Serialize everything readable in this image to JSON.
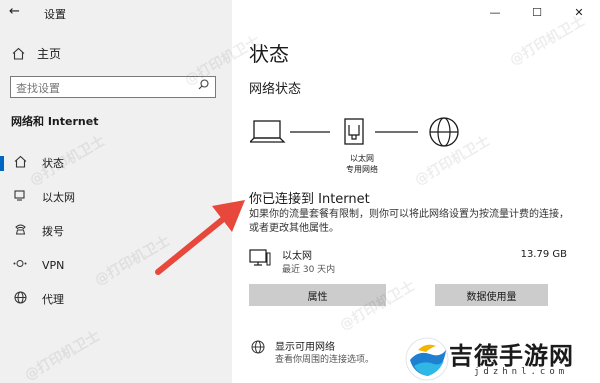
{
  "window": {
    "back_glyph": "←",
    "title": "设置",
    "min_glyph": "—",
    "max_glyph": "☐",
    "close_glyph": "✕"
  },
  "sidebar": {
    "home_label": "主页",
    "search_placeholder": "查找设置",
    "section_title": "网络和 Internet",
    "items": [
      {
        "label": "状态",
        "icon": "home-icon",
        "active": true
      },
      {
        "label": "以太网",
        "icon": "ethernet-icon",
        "active": false
      },
      {
        "label": "拨号",
        "icon": "phone-icon",
        "active": false
      },
      {
        "label": "VPN",
        "icon": "vpn-icon",
        "active": false
      },
      {
        "label": "代理",
        "icon": "globe-icon",
        "active": false
      }
    ]
  },
  "main": {
    "page_title": "状态",
    "network_status_title": "网络状态",
    "diagram_label_1": "以太网",
    "diagram_label_2": "专用网络",
    "connected_title": "你已连接到 Internet",
    "connected_desc": "如果你的流量套餐有限制，则你可以将此网络设置为按流量计费的连接，或者更改其他属性。",
    "connection": {
      "name": "以太网",
      "sub": "最近 30 天内",
      "size": "13.79 GB"
    },
    "buttons": {
      "properties": "属性",
      "data_usage": "数据使用量"
    },
    "show_networks": {
      "title": "显示可用网络",
      "sub": "查看你周围的连接选项。"
    }
  },
  "watermark_text": "@打印机卫士",
  "brand": {
    "name": "吉德手游网",
    "url": "jdzhnl.com"
  },
  "colors": {
    "accent": "#0067c0",
    "arrow": "#e8473c"
  }
}
